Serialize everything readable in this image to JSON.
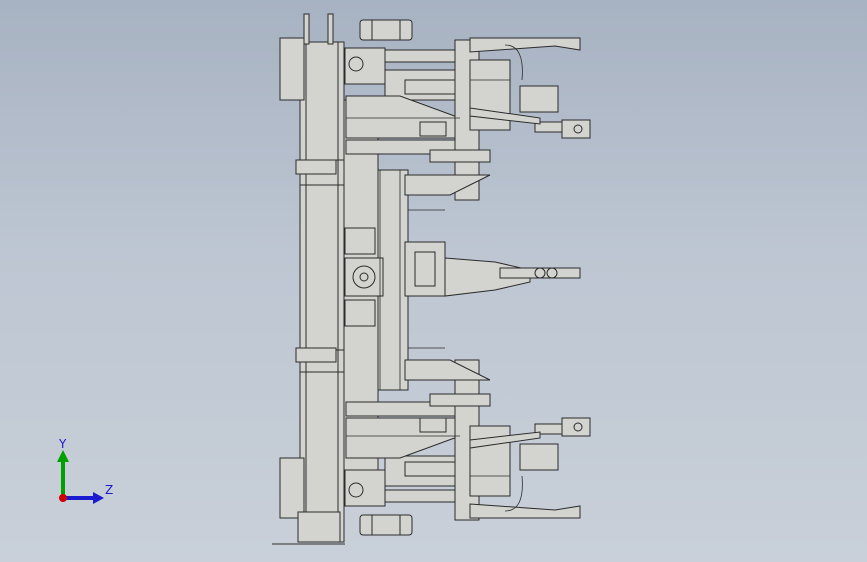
{
  "viewport": {
    "background_top": "#a7b2c2",
    "background_bottom": "#c9d0d9",
    "model_fill": "#d3d3cf",
    "model_stroke": "#2b2b2b"
  },
  "triad": {
    "y_label": "Y",
    "z_label": "Z",
    "y_color": "#00a000",
    "z_color": "#1a1ad0",
    "origin_color": "#d00000"
  }
}
